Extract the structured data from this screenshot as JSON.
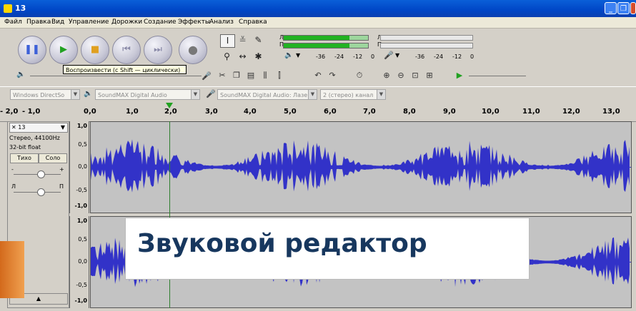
{
  "window": {
    "title": "13"
  },
  "menu": [
    "Файл",
    "Правка",
    "Вид",
    "Управление",
    "Дорожки",
    "Создание",
    "Эффекты",
    "Анализ",
    "Справка"
  ],
  "transport": {
    "buttons": [
      "pause",
      "play",
      "stop",
      "skip-to-start",
      "skip-to-end",
      "record"
    ]
  },
  "meters": {
    "playback_label_l": "Л",
    "playback_label_r": "П",
    "record_label_l": "Л",
    "record_label_r": "П",
    "scale": [
      "-36",
      "-24",
      "-12",
      "0"
    ],
    "playback_level_fraction": 0.78
  },
  "tooltip": "Воспроизвести (с Shift — циклически)",
  "devices": {
    "host": "Windows DirectSo",
    "output": "SoundMAX Digital Audio",
    "input": "SoundMAX Digital Audio: Лазе",
    "channels": "2 (стерео) канал"
  },
  "ruler": {
    "ticks": [
      "2,0",
      "1,0",
      "0,0",
      "1,0",
      "2,0",
      "3,0",
      "4,0",
      "5,0",
      "6,0",
      "7,0",
      "8,0",
      "9,0",
      "10,0",
      "11,0",
      "12,0",
      "13,0"
    ],
    "prefix_ticks": [
      "- 2,0",
      "- 1,0"
    ]
  },
  "track": {
    "name": "13",
    "info": [
      "Стерео, 44100Hz",
      "32-bit float"
    ],
    "mute": "Тихо",
    "solo": "Соло",
    "gain_minus": "-",
    "gain_plus": "+",
    "pan_l": "Л",
    "pan_r": "П",
    "scale_top": [
      "1,0",
      "0,5",
      "0,0",
      "-0,5",
      "-1,0"
    ],
    "scale_bottom": [
      "1,0",
      "0,5",
      "0,0",
      "-0,5",
      "-1,0"
    ]
  },
  "overlay_label": "Звуковой  редактор",
  "colors": {
    "waveform": "#3232c8",
    "title_bar": "#0a5fd8",
    "play_green": "#21a121",
    "record_gray": "#787878",
    "label_text": "#17375e"
  }
}
